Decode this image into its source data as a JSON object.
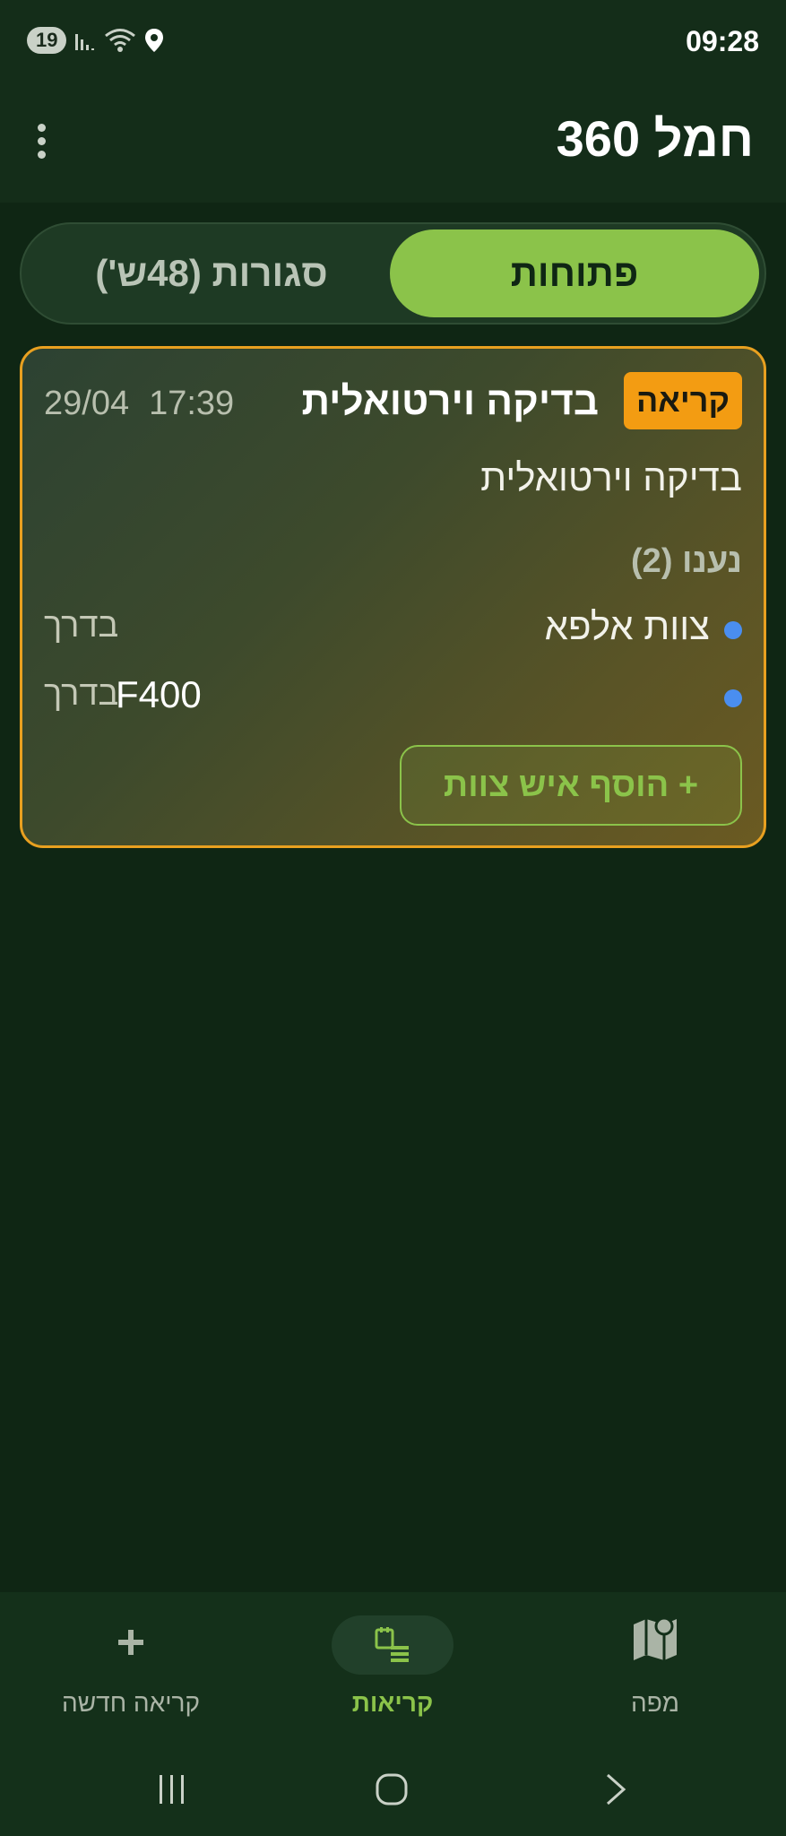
{
  "status_bar": {
    "time": "09:28",
    "notification_count": "19",
    "icons": [
      "signal-icon",
      "wifi-icon",
      "location-icon"
    ]
  },
  "header": {
    "title": "חמל 360",
    "menu_icon": "kebab-menu-icon"
  },
  "tabs": [
    {
      "label": "פתוחות",
      "active": true
    },
    {
      "label": "סגורות (48ש')",
      "active": false
    }
  ],
  "card": {
    "tag": "קריאה",
    "title": "בדיקה וירטואלית",
    "time": "17:39",
    "date": "29/04",
    "description": "בדיקה וירטואלית",
    "responders_heading": "נענו (2)",
    "responders": [
      {
        "name": "צוות אלפא",
        "code": "",
        "status": "בדרך"
      },
      {
        "name": "",
        "code": "F400",
        "status": "בדרך"
      }
    ],
    "add_button": "+ הוסף איש צוות"
  },
  "bottom_nav": {
    "items": [
      {
        "label": "מפה",
        "icon": "map-icon"
      },
      {
        "label": "קריאות",
        "icon": "calls-icon",
        "active": true
      },
      {
        "label": "קריאה חדשה",
        "icon": "plus-icon"
      }
    ]
  },
  "colors": {
    "accent": "#8bc34a",
    "tag": "#f39c12",
    "card_border": "#e8a020",
    "dot": "#4a8ef0"
  }
}
